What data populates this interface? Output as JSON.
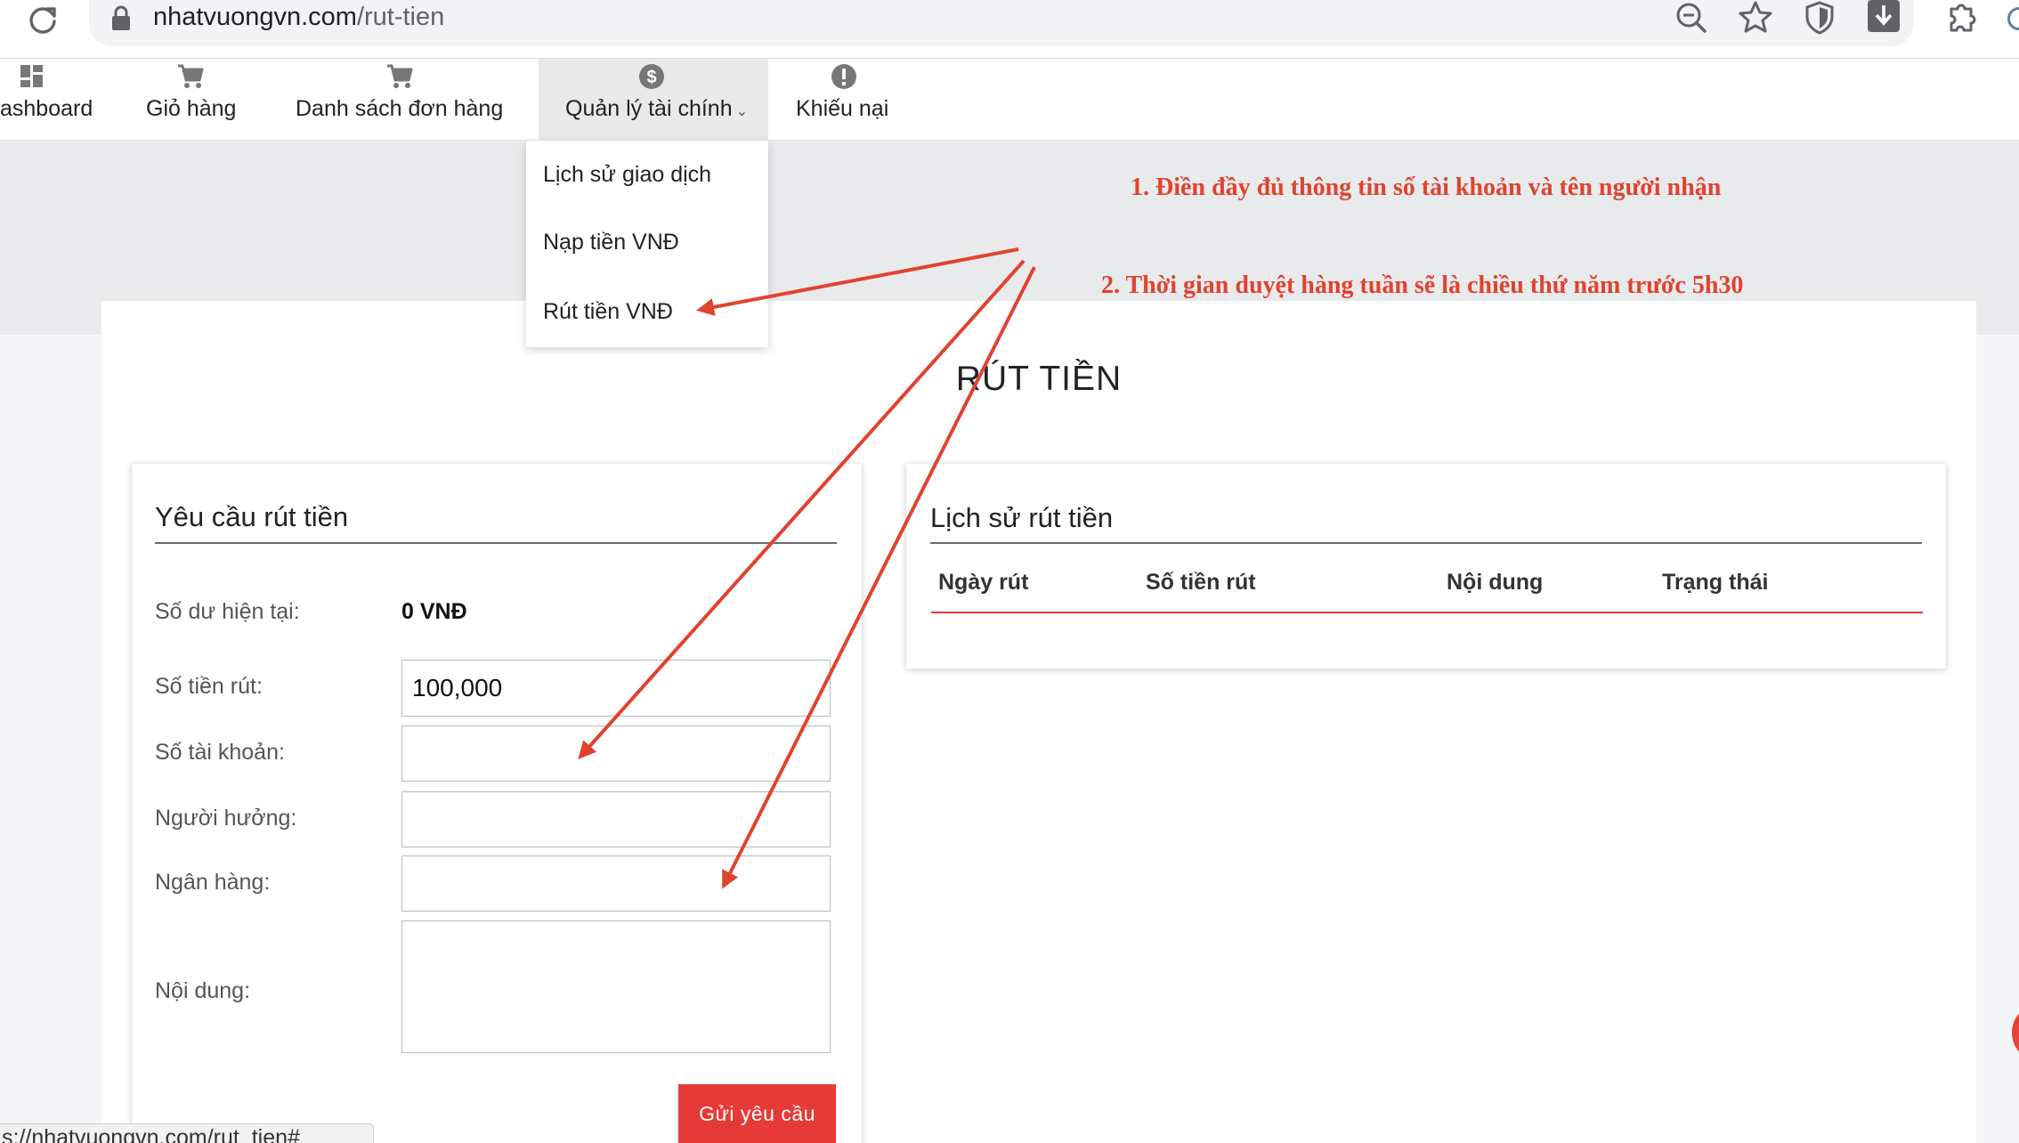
{
  "browser": {
    "url_host": "nhatvuongvn.com",
    "url_path": "/rut-tien",
    "status_url": "s://nhatvuongvn.com/rut_tien#"
  },
  "nav": {
    "items": [
      {
        "label": "ashboard",
        "icon": "dashboard-icon"
      },
      {
        "label": "Giỏ hàng",
        "icon": "cart-icon"
      },
      {
        "label": "Danh sách đơn hàng",
        "icon": "cart-icon"
      },
      {
        "label": "Quản lý tài chính",
        "icon": "dollar-icon",
        "active": true
      },
      {
        "label": "Khiếu nại",
        "icon": "alert-icon"
      }
    ]
  },
  "dropdown": {
    "items": [
      "Lịch sử giao dịch",
      "Nạp tiền VNĐ",
      "Rút tiền VNĐ"
    ]
  },
  "page": {
    "title": "RÚT TIỀN"
  },
  "request_form": {
    "title": "Yêu cầu rút tiền",
    "balance_label": "Số dư hiện tại:",
    "balance_value": "0 VNĐ",
    "amount_label": "Số tiền rút:",
    "amount_value": "100,000",
    "account_label": "Số tài khoản:",
    "account_value": "",
    "beneficiary_label": "Người hưởng:",
    "beneficiary_value": "",
    "bank_label": "Ngân hàng:",
    "bank_value": "",
    "content_label": "Nội dung:",
    "content_value": "",
    "submit_label": "Gửi yêu cầu"
  },
  "history": {
    "title": "Lịch sử rút tiền",
    "columns": [
      "Ngày rút",
      "Số tiền rút",
      "Nội dung",
      "Trạng thái"
    ]
  },
  "annotations": {
    "note1": "1. Điền đầy đủ thông tin số tài khoản và tên người nhận",
    "note2": "2. Thời gian duyệt hàng tuần sẽ là chiều thứ năm trước 5h30"
  },
  "colors": {
    "accent": "#e63a37",
    "annotation": "#e0432f"
  }
}
